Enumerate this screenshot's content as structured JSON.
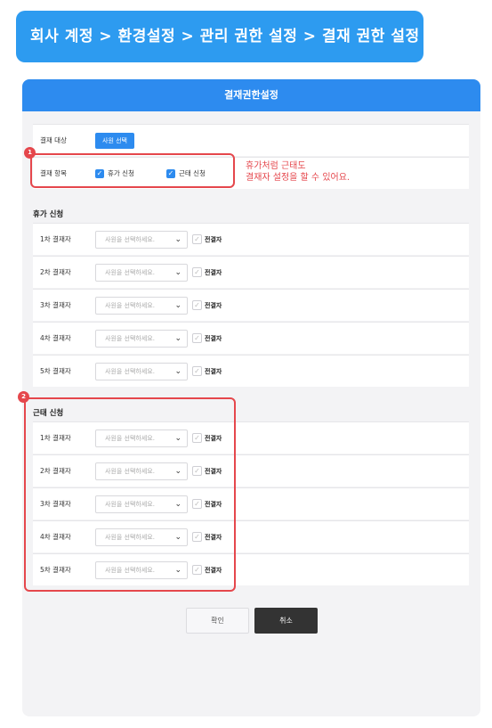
{
  "breadcrumb": {
    "text": "회사 계정 > 환경설정 > 관리 권한 설정 > 결재 권한 설정"
  },
  "panel": {
    "title": "결재권한설정"
  },
  "target": {
    "label": "결재 대상",
    "button": "사원 선택"
  },
  "items": {
    "label": "결재 항목",
    "leave": "휴가 신청",
    "attendance": "근태 신청"
  },
  "note": {
    "line1": "휴가처럼 근태도",
    "line2": "결재자 설정을 할 수 있어요."
  },
  "leave_section": {
    "title": "휴가 신청",
    "rows": [
      {
        "label": "1차 결재자",
        "placeholder": "사원을 선택하세요.",
        "pre": "전결자"
      },
      {
        "label": "2차 결재자",
        "placeholder": "사원을 선택하세요.",
        "pre": "전결자"
      },
      {
        "label": "3차 결재자",
        "placeholder": "사원을 선택하세요.",
        "pre": "전결자"
      },
      {
        "label": "4차 결재자",
        "placeholder": "사원을 선택하세요.",
        "pre": "전결자"
      },
      {
        "label": "5차 결재자",
        "placeholder": "사원을 선택하세요.",
        "pre": "전결자"
      }
    ]
  },
  "attendance_section": {
    "title": "근태 신청",
    "rows": [
      {
        "label": "1차 결재자",
        "placeholder": "사원을 선택하세요.",
        "pre": "전결자"
      },
      {
        "label": "2차 결재자",
        "placeholder": "사원을 선택하세요.",
        "pre": "전결자"
      },
      {
        "label": "3차 결재자",
        "placeholder": "사원을 선택하세요.",
        "pre": "전결자"
      },
      {
        "label": "4차 결재자",
        "placeholder": "사원을 선택하세요.",
        "pre": "전결자"
      },
      {
        "label": "5차 결재자",
        "placeholder": "사원을 선택하세요.",
        "pre": "전결자"
      }
    ]
  },
  "badges": {
    "one": "1",
    "two": "2"
  },
  "footer": {
    "confirm": "확인",
    "cancel": "취소"
  },
  "colors": {
    "accent": "#2d8bef",
    "highlight": "#e5474c"
  }
}
